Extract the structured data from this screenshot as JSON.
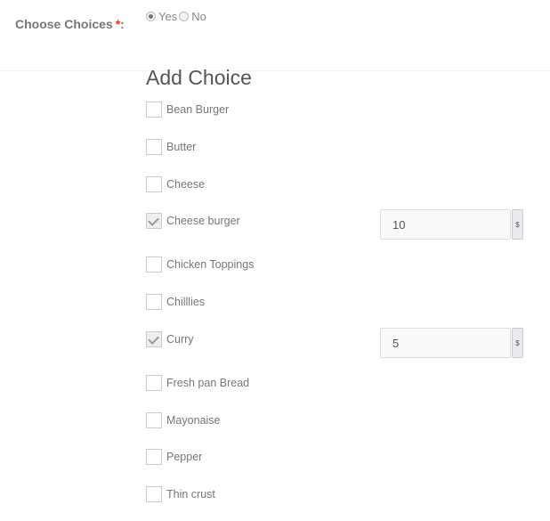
{
  "form": {
    "field_label": "Choose Choices",
    "required_mark": "*",
    "label_suffix": ":",
    "radio_options": [
      {
        "label": "Yes",
        "checked": true
      },
      {
        "label": "No",
        "checked": false
      }
    ]
  },
  "section": {
    "title": "Add Choice"
  },
  "currency_symbol": "$",
  "choices": [
    {
      "label": "Bean Burger",
      "checked": false,
      "price": null
    },
    {
      "label": "Butter",
      "checked": false,
      "price": null
    },
    {
      "label": "Cheese",
      "checked": false,
      "price": null
    },
    {
      "label": "Cheese burger",
      "checked": true,
      "price": "10"
    },
    {
      "label": "Chicken Toppings",
      "checked": false,
      "price": null
    },
    {
      "label": "Chilllies",
      "checked": false,
      "price": null
    },
    {
      "label": "Curry",
      "checked": true,
      "price": "5"
    },
    {
      "label": "Fresh pan Bread",
      "checked": false,
      "price": null
    },
    {
      "label": "Mayonaise",
      "checked": false,
      "price": null
    },
    {
      "label": "Pepper",
      "checked": false,
      "price": null
    },
    {
      "label": "Thin crust",
      "checked": false,
      "price": null
    }
  ]
}
